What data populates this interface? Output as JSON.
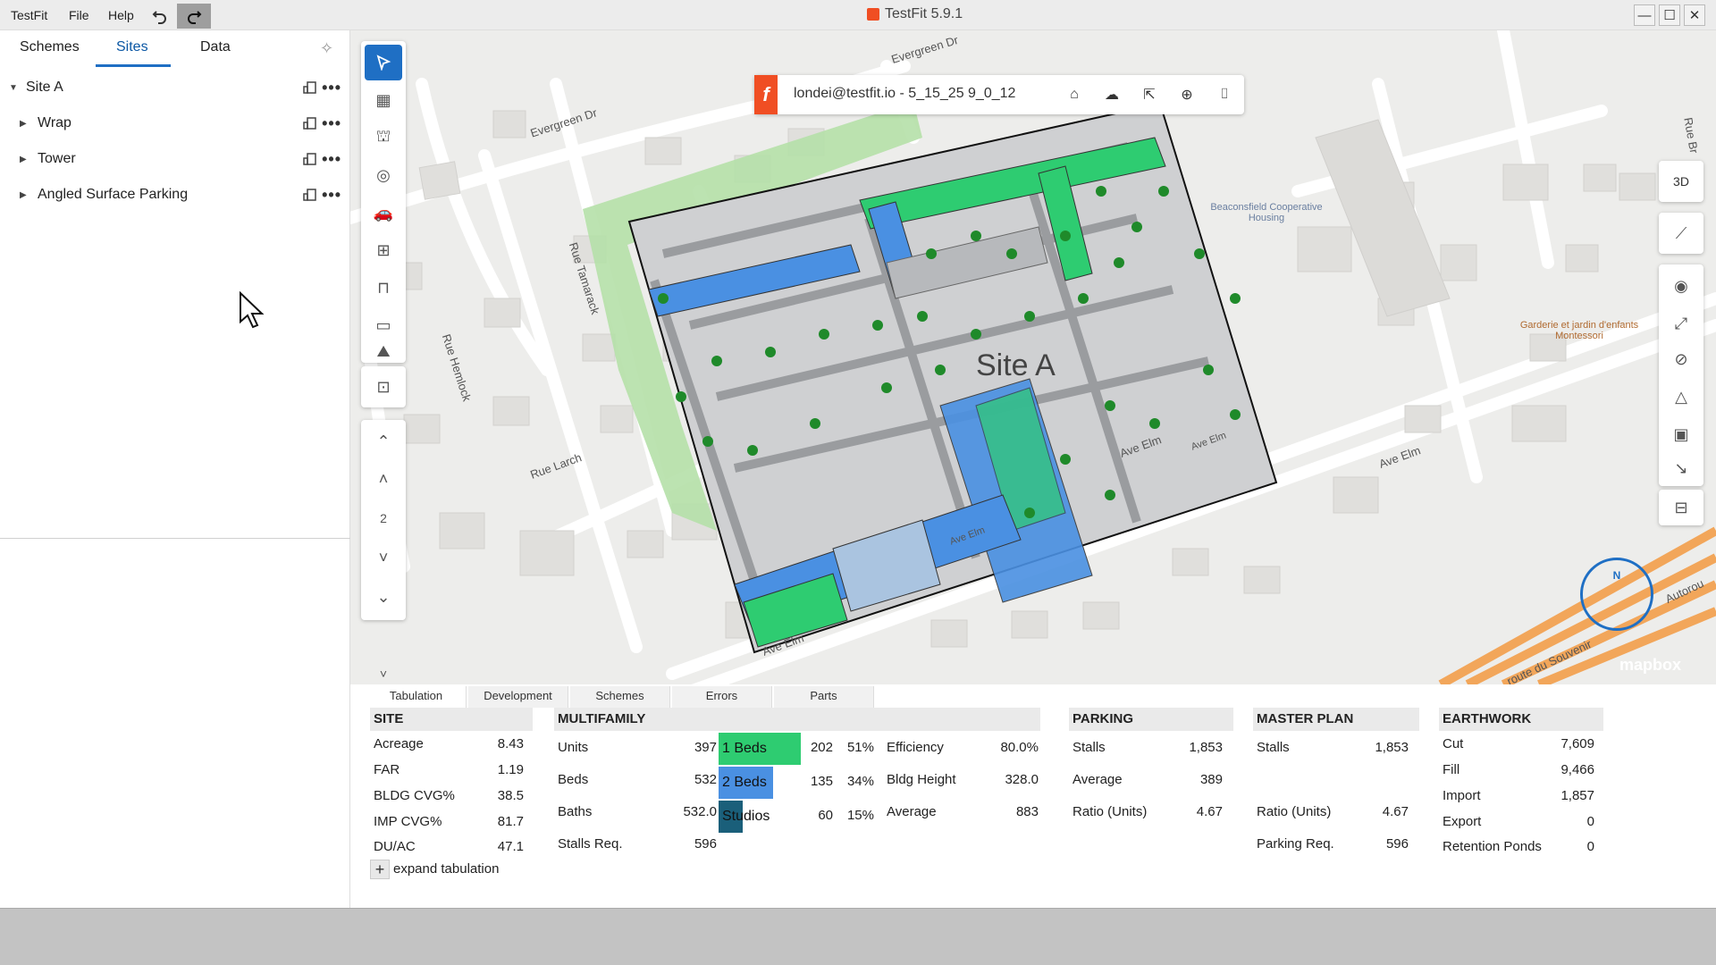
{
  "titlebar": {
    "menu": [
      "TestFit",
      "File",
      "Help"
    ],
    "app_title": "TestFit 5.9.1",
    "undo_icon": "undo-icon",
    "redo_icon": "redo-icon"
  },
  "left_panel": {
    "tabs": [
      "Schemes",
      "Sites",
      "Data"
    ],
    "active_tab": "Sites",
    "tree": [
      {
        "label": "Site A",
        "expanded": true
      },
      {
        "label": "Wrap"
      },
      {
        "label": "Tower"
      },
      {
        "label": "Angled Surface Parking"
      }
    ]
  },
  "map": {
    "user_scheme": "londei@testfit.io - 5_15_25 9_0_12",
    "site_label": "Site A",
    "roads": [
      "Evergreen Dr",
      "Evergreen Dr",
      "Rue Tamarack",
      "Rue Hemlock",
      "Rue Larch",
      "Ave Elm",
      "Ave Elm",
      "Ave Elm",
      "Ave Elm",
      "Ave Elm",
      "Rue Br",
      "Autorou",
      "route du Souvenir"
    ],
    "pois": [
      "Beaconsfield Cooperative Housing",
      "Garderie et jardin d'enfants Montessori"
    ],
    "level": "2",
    "view_3d": "3D",
    "attribution": "mapbox",
    "compass": "N"
  },
  "bottom_tabs": [
    "Tabulation",
    "Development",
    "Schemes",
    "Errors",
    "Parts"
  ],
  "tabulation": {
    "site": {
      "title": "SITE",
      "rows": [
        [
          "Acreage",
          "8.43"
        ],
        [
          "FAR",
          "1.19"
        ],
        [
          "BLDG CVG%",
          "38.5"
        ],
        [
          "IMP CVG%",
          "81.7"
        ],
        [
          "DU/AC",
          "47.1"
        ]
      ]
    },
    "multifamily": {
      "title": "MULTIFAMILY",
      "rows": [
        [
          "Units",
          "397"
        ],
        [
          "Beds",
          "532"
        ],
        [
          "Baths",
          "532.0"
        ],
        [
          "Stalls Req.",
          "596"
        ]
      ],
      "mix": [
        {
          "label": "1 Beds",
          "count": "202",
          "pct": "51%",
          "color": "#2ecc71"
        },
        {
          "label": "2 Beds",
          "count": "135",
          "pct": "34%",
          "color": "#4a90e2"
        },
        {
          "label": "Studios",
          "count": "60",
          "pct": "15%",
          "color": "#1a5f7a"
        }
      ],
      "stats": [
        [
          "Efficiency",
          "80.0%"
        ],
        [
          "Bldg Height",
          "328.0"
        ],
        [
          "Average",
          "883"
        ]
      ]
    },
    "parking": {
      "title": "PARKING",
      "rows": [
        [
          "Stalls",
          "1,853"
        ],
        [
          "Average",
          "389"
        ],
        [
          "Ratio (Units)",
          "4.67"
        ]
      ]
    },
    "master_plan": {
      "title": "MASTER PLAN",
      "rows": [
        [
          "Stalls",
          "1,853"
        ],
        [
          "Ratio (Units)",
          "4.67"
        ],
        [
          "Parking Req.",
          "596"
        ]
      ]
    },
    "earthwork": {
      "title": "EARTHWORK",
      "rows": [
        [
          "Cut",
          "7,609"
        ],
        [
          "Fill",
          "9,466"
        ],
        [
          "Import",
          "1,857"
        ],
        [
          "Export",
          "0"
        ],
        [
          "Retention Ponds",
          "0"
        ]
      ]
    },
    "expand_label": "expand tabulation"
  }
}
